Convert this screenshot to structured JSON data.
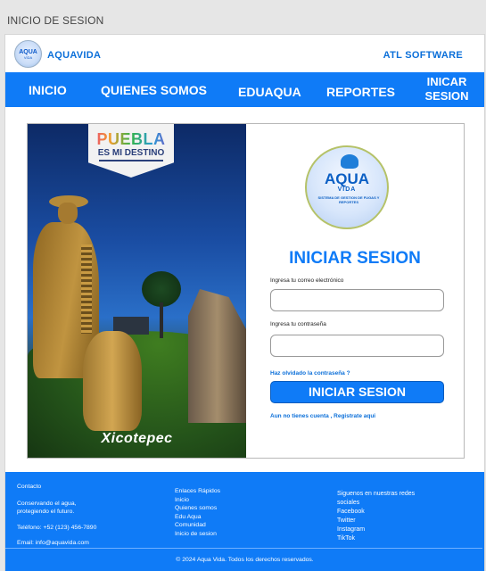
{
  "window": {
    "title": "INICIO DE SESION"
  },
  "header": {
    "logo_text": "AQUA",
    "logo_subtext": "VIDA",
    "brand": "AQUAVIDA",
    "partner": "ATL SOFTWARE"
  },
  "nav": {
    "items": [
      "INICIO",
      "QUIENES SOMOS",
      "EDUAQUA",
      "REPORTES",
      "INICAR SESION"
    ]
  },
  "poster": {
    "title": "PUEBLA",
    "subtitle": "ES MI DESTINO",
    "caption": "Xicotepec"
  },
  "login": {
    "logo_title": "AQUA",
    "logo_sub": "VIDA",
    "logo_tagline": "SISTEMA DE GESTION DE FUGAS Y REPORTES",
    "title": "INICIAR SESION",
    "email_label": "Ingresa tu correo electrónico",
    "email_value": "",
    "password_label": "Ingresa tu contraseña",
    "password_value": "",
    "forgot": "Haz olvidado la contraseña ?",
    "submit": "INICIAR SESION",
    "register": "Aun no tienes cuenta , Registrate aqui"
  },
  "footer": {
    "contact": {
      "heading": "Contacto",
      "lines": [
        "Conservando el agua,",
        "protegiendo el futuro."
      ],
      "phone": "Teléfono: +52 (123) 456-7890",
      "email": "Email: info@aquavida.com"
    },
    "quick_links": {
      "heading": "Enlaces Rápidos",
      "links": [
        "Inicio",
        "Quienes somos",
        "Edu Aqua",
        "Comunidad",
        "Inicio de sesion"
      ]
    },
    "social": {
      "heading": "Siguenos en nuestras redes sociales",
      "links": [
        "Facebook",
        "Twitter",
        "Instagram",
        "TikTok"
      ]
    },
    "copyright": "© 2024 Aqua Vida. Todos los derechos reservados."
  },
  "colors": {
    "primary": "#0f7bf7",
    "background": "#e6e6e6",
    "text_link": "#0b6fd9"
  }
}
